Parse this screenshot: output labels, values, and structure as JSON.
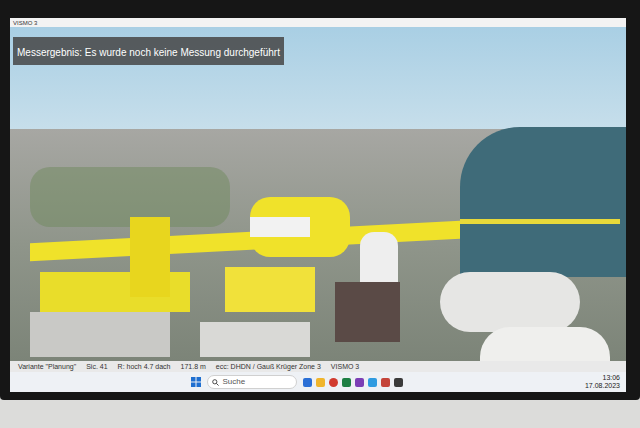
{
  "window": {
    "title": "VISMO 3"
  },
  "overlay": {
    "message": "Messergebnis: Es wurde noch keine Messung durchgeführt"
  },
  "status_bar": [
    "Variante \"Planung\"",
    "Sic. 41",
    "R: hoch 4.7 dach",
    "171.8 m",
    "ecc: DHDN / Gauß Krüger Zone 3",
    "VISMO 3"
  ],
  "taskbar": {
    "search": {
      "placeholder": "Suche"
    },
    "clock": {
      "time": "13:06",
      "date": "17.08.2023"
    }
  }
}
